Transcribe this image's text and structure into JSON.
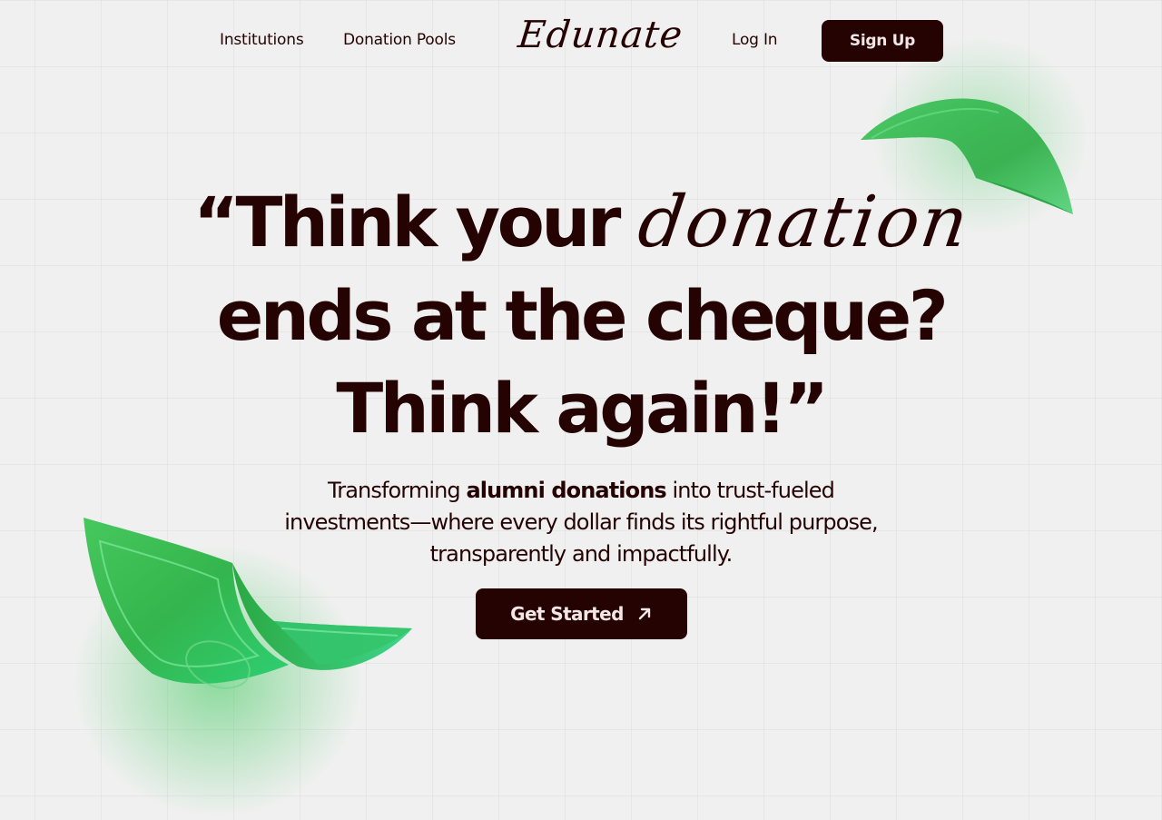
{
  "nav": {
    "links": [
      {
        "label": "Institutions"
      },
      {
        "label": "Donation Pools"
      }
    ],
    "logo": "Edunate",
    "login_label": "Log In",
    "signup_label": "Sign Up"
  },
  "hero": {
    "headline": {
      "line1_prefix": "“Think your ",
      "line1_script": "donation",
      "line2": "ends at the cheque?",
      "line3": "Think again!”"
    },
    "subtitle": {
      "part1": "Transforming ",
      "bold": "alumni donations",
      "part2": " into trust-fueled",
      "line2": "investments—where every dollar finds its rightful purpose,",
      "line3": "transparently and impactfully."
    },
    "cta_label": "Get Started",
    "cta_icon": "arrow-up-right-icon"
  },
  "decor": {
    "bills": [
      "money-bill-icon",
      "money-bill-icon"
    ]
  },
  "colors": {
    "background": "#f0f0f0",
    "text": "#250303",
    "button_bg": "#250303",
    "button_text": "#f3e6e6",
    "bill_green": "#2fb84a",
    "bill_green_light": "#4ad36b"
  }
}
